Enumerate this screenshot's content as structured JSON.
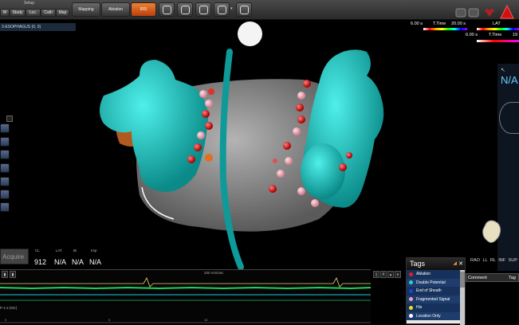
{
  "toolbar": {
    "setup_label": "Setup",
    "tabs": [
      "W",
      "Study",
      "Loc.",
      "Cath",
      "Map"
    ],
    "mapping_label": "Mapping",
    "ablation_label": "Ablation",
    "active_label": "IRS"
  },
  "map_title": "3-ESOPHAGUS (0, 0)",
  "legend": {
    "row1_time": "6.00 s",
    "row1_label": "T.Time",
    "row1_value": "20.00 s",
    "row1_mode": "LAT",
    "row2_time": "6.00 s",
    "row2_label": "T.Time",
    "row2_value": "19"
  },
  "right_nav": {
    "nav_label": "N/A"
  },
  "views": "RAO LL RL INF SUP",
  "data_panel": {
    "acquire_label": "Acquire",
    "headers": [
      "CL",
      "LAT",
      "Bi",
      "Imp"
    ],
    "values": [
      "912",
      "N/A",
      "N/A",
      "N/A"
    ]
  },
  "ecg": {
    "scale": "200 mm/sec",
    "channel_label": "P 1-2 (NC)",
    "grid_marks": [
      "0",
      "5",
      "10"
    ]
  },
  "tags": {
    "title": "Tags",
    "items": [
      {
        "label": "Ablation",
        "color": "#e02020"
      },
      {
        "label": "Double Potential",
        "color": "#30d0d0"
      },
      {
        "label": "End of Sheath",
        "color": "#2040e0"
      },
      {
        "label": "Fragmented Signal",
        "color": "#f0a0c0"
      },
      {
        "label": "His",
        "color": "#f0e020"
      },
      {
        "label": "Location Only",
        "color": "#ffffff"
      }
    ]
  },
  "comment_panel": {
    "col1": "Comment",
    "col2": "Tag"
  },
  "colors": {
    "anatomy_cyan": "#14c8c4",
    "anatomy_gray": "#8e8e8e",
    "accent_orange": "#e36c22"
  }
}
